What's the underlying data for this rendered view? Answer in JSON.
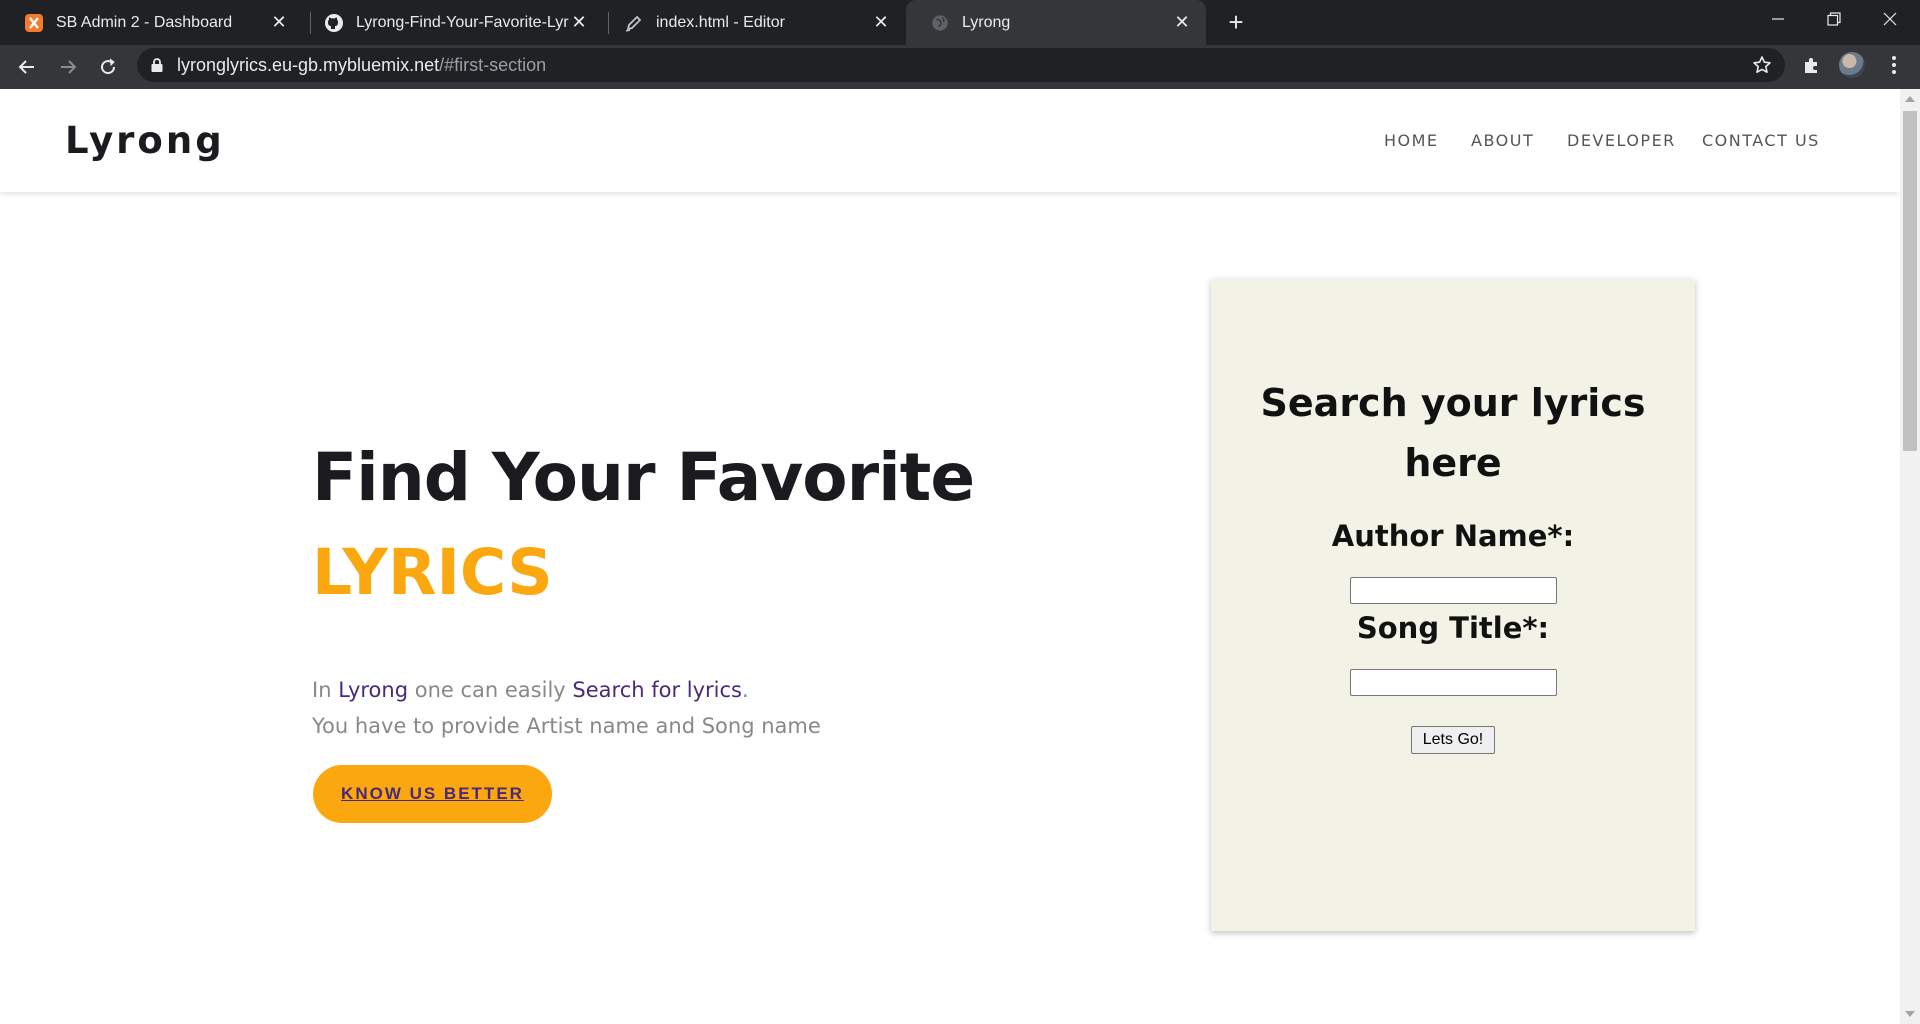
{
  "browser": {
    "tabs": [
      {
        "title": "SB Admin 2 - Dashboard",
        "icon": "xampp-icon",
        "active": false
      },
      {
        "title": "Lyrong-Find-Your-Favorite-Lyrics/",
        "icon": "github-icon",
        "active": false
      },
      {
        "title": "index.html - Editor",
        "icon": "pen-icon",
        "active": false
      },
      {
        "title": "Lyrong",
        "icon": "globe-icon",
        "active": true
      }
    ],
    "address": {
      "host": "lyronglyrics.eu-gb.mybluemix.net",
      "path": "/#first-section"
    }
  },
  "site": {
    "brand": "Lyrong",
    "nav": [
      "HOME",
      "ABOUT",
      "DEVELOPER",
      "CONTACT US"
    ]
  },
  "hero": {
    "title": "Find Your Favorite",
    "accent": "LYRICS",
    "line1": {
      "prefix": "In ",
      "brand": "Lyrong",
      "middle": " one can easily ",
      "link": "Search for lyrics",
      "suffix": "."
    },
    "line2": "You have to provide Artist name and Song name",
    "cta": "KNOW US BETTER"
  },
  "search_form": {
    "title_line1": "Search your lyrics",
    "title_line2": "here",
    "author_label": "Author Name*:",
    "author_value": "",
    "song_label": "Song Title*:",
    "song_value": "",
    "submit": "Lets Go!"
  },
  "colors": {
    "accent": "#fba70f",
    "link": "#4a2a78",
    "card_bg": "#f2f2e6",
    "heading": "#1b1b1f"
  }
}
